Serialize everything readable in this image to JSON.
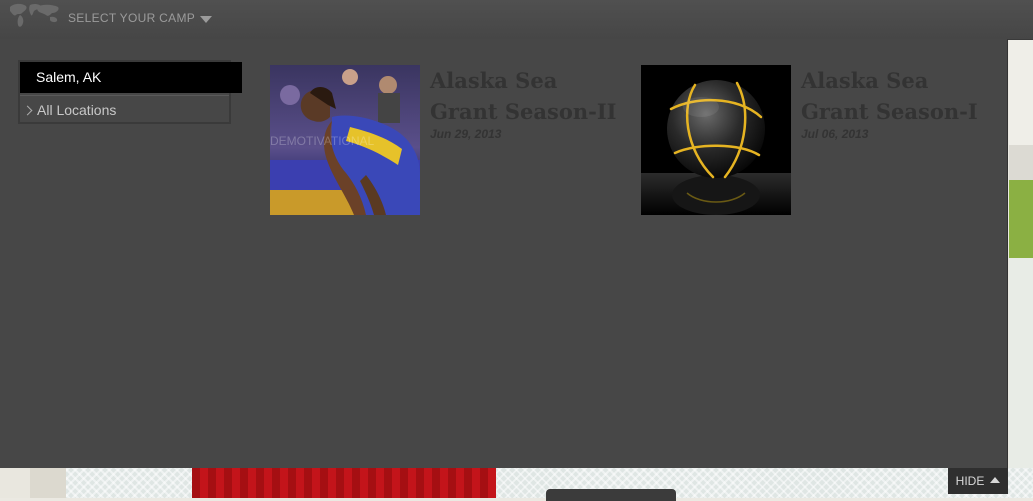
{
  "header": {
    "camp_selector_label": "SELECT YOUR CAMP",
    "globe_icon": "world-map-icon",
    "caret_icon": "caret-down-icon"
  },
  "locations": {
    "selected": "Salem, AK",
    "all_label": "All Locations"
  },
  "camps": [
    {
      "title": "Alaska Sea Grant Season-II",
      "date": "Jun 29, 2013",
      "thumbnail_icon": "basketball-player-photo",
      "watermark": "DEMOTIVATIONAL"
    },
    {
      "title": "Alaska Sea Grant Season-I",
      "date": "Jul 06, 2013",
      "thumbnail_icon": "basketball-photo"
    }
  ],
  "footer": {
    "hide_label": "HIDE",
    "hide_icon": "caret-up-icon"
  },
  "colors": {
    "panel": "#474747",
    "title_text": "#333333",
    "selected_bg": "#000000",
    "accent_green": "#8bb043",
    "accent_red": "#a50f12"
  }
}
